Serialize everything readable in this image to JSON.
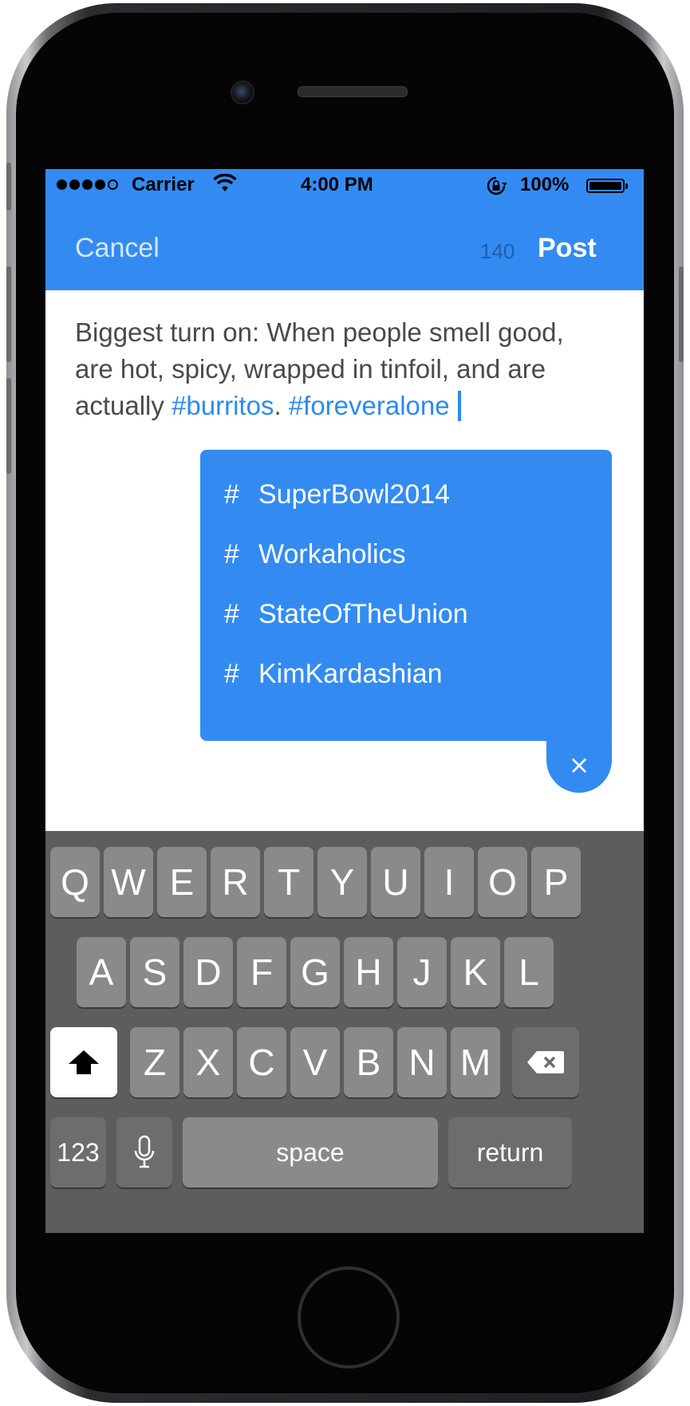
{
  "status_bar": {
    "carrier": "Carrier",
    "time": "4:00 PM",
    "battery": "100%"
  },
  "nav": {
    "cancel": "Cancel",
    "char_count": "140",
    "post": "Post"
  },
  "compose": {
    "line1": "Biggest turn on: When people smell good,",
    "line2": "are hot, spicy, wrapped in tinfoil, and are",
    "line3_prefix": "actually ",
    "hashtag1": "#burritos",
    "separator": ". ",
    "hashtag2": "#foreveralone"
  },
  "suggestions": {
    "hash_symbol": "#",
    "items": [
      "SuperBowl2014",
      "Workaholics",
      "StateOfTheUnion",
      "KimKardashian"
    ],
    "close": "×"
  },
  "keyboard": {
    "row1": [
      "Q",
      "W",
      "E",
      "R",
      "T",
      "Y",
      "U",
      "I",
      "O",
      "P"
    ],
    "row2": [
      "A",
      "S",
      "D",
      "F",
      "G",
      "H",
      "J",
      "K",
      "L"
    ],
    "row3": [
      "Z",
      "X",
      "C",
      "V",
      "B",
      "N",
      "M"
    ],
    "numbers": "123",
    "space": "space",
    "return": "return"
  },
  "icons": {
    "wifi": "wifi-icon",
    "lock": "rotation-lock-icon",
    "shift": "shift-icon",
    "delete": "delete-icon",
    "mic": "microphone-icon"
  },
  "colors": {
    "accent": "#338bf2",
    "hashtag": "#2b8af0",
    "keyboard_bg": "#5d5d5d",
    "key": "#8a8a8a"
  }
}
